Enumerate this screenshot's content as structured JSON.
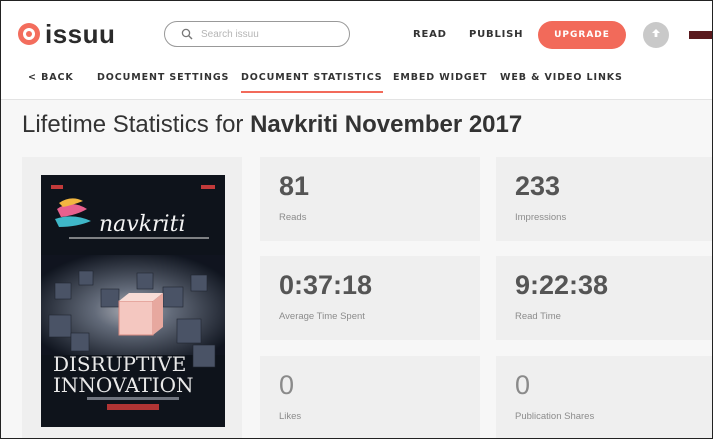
{
  "brand": {
    "name": "issuu"
  },
  "search": {
    "placeholder": "Search issuu"
  },
  "header": {
    "read_label": "READ",
    "publish_label": "PUBLISH",
    "upgrade_label": "UPGRADE"
  },
  "subnav": {
    "back_label": "< BACK",
    "items": [
      {
        "label": "DOCUMENT SETTINGS",
        "active": false
      },
      {
        "label": "DOCUMENT STATISTICS",
        "active": true
      },
      {
        "label": "EMBED WIDGET",
        "active": false
      },
      {
        "label": "WEB & VIDEO LINKS",
        "active": false
      }
    ]
  },
  "page": {
    "title_prefix": "Lifetime Statistics for ",
    "document_name": "Navkriti November 2017"
  },
  "cover": {
    "masthead": "navkriti",
    "headline_line1": "DISRUPTIVE",
    "headline_line2": "INNOVATION"
  },
  "stats": [
    {
      "value": "81",
      "label": "Reads"
    },
    {
      "value": "233",
      "label": "Impressions"
    },
    {
      "value": "0:37:18",
      "label": "Average Time Spent"
    },
    {
      "value": "9:22:38",
      "label": "Read Time"
    },
    {
      "value": "0",
      "label": "Likes"
    },
    {
      "value": "0",
      "label": "Publication Shares"
    }
  ],
  "colors": {
    "accent": "#f26a5a",
    "card_bg": "#efefef",
    "page_bg": "#f7f7f7",
    "text_dark": "#333333"
  }
}
